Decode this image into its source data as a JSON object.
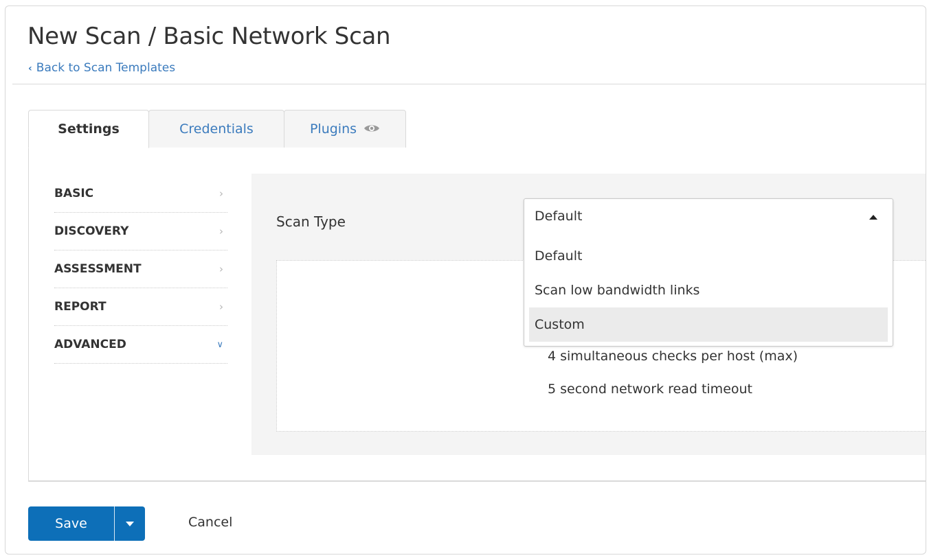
{
  "header": {
    "title": "New Scan / Basic Network Scan",
    "back_link": "Back to Scan Templates",
    "back_icon": "chevron-left-icon"
  },
  "tabs": [
    {
      "label": "Settings",
      "active": true
    },
    {
      "label": "Credentials",
      "active": false
    },
    {
      "label": "Plugins",
      "active": false,
      "icon": "eye-icon"
    }
  ],
  "sidebar": {
    "items": [
      {
        "label": "BASIC",
        "icon": "chevron-right-icon"
      },
      {
        "label": "DISCOVERY",
        "icon": "chevron-right-icon"
      },
      {
        "label": "ASSESSMENT",
        "icon": "chevron-right-icon"
      },
      {
        "label": "REPORT",
        "icon": "chevron-right-icon"
      },
      {
        "label": "ADVANCED",
        "icon": "chevron-down-icon",
        "expanded": true
      }
    ]
  },
  "main": {
    "scan_type_label": "Scan Type",
    "scan_type": {
      "selected": "Default",
      "open": true,
      "options": [
        "Default",
        "Scan low bandwidth links",
        "Custom"
      ],
      "hovered": "Custom"
    },
    "details": [
      "4 simultaneous checks per host (max)",
      "5 second network read timeout"
    ]
  },
  "footer": {
    "save_label": "Save",
    "cancel_label": "Cancel"
  },
  "colors": {
    "link": "#3b7bbd",
    "primary_button": "#0d6fb8",
    "panel_bg": "#f4f4f4",
    "option_hover": "#ebebeb"
  }
}
